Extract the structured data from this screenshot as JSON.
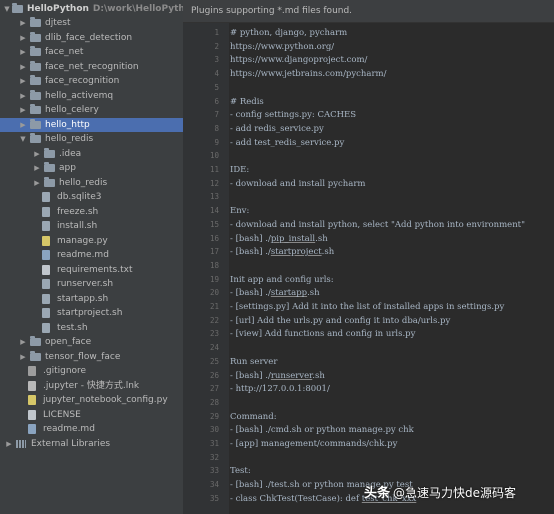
{
  "project": {
    "name": "HelloPython",
    "path": "D:\\work\\HelloPython"
  },
  "tree": [
    {
      "label": "djtest",
      "type": "folder",
      "arrow": "collapsed"
    },
    {
      "label": "dlib_face_detection",
      "type": "folder",
      "arrow": "collapsed"
    },
    {
      "label": "face_net",
      "type": "folder",
      "arrow": "collapsed"
    },
    {
      "label": "face_net_recognition",
      "type": "folder",
      "arrow": "collapsed"
    },
    {
      "label": "face_recognition",
      "type": "folder",
      "arrow": "collapsed"
    },
    {
      "label": "hello_activemq",
      "type": "folder",
      "arrow": "collapsed"
    },
    {
      "label": "hello_celery",
      "type": "folder",
      "arrow": "collapsed"
    },
    {
      "label": "hello_http",
      "type": "folder",
      "arrow": "collapsed",
      "selected": true
    },
    {
      "label": "hello_redis",
      "type": "folder",
      "arrow": "expanded"
    },
    {
      "label": ".idea",
      "type": "folder",
      "arrow": "collapsed"
    },
    {
      "label": "app",
      "type": "folder",
      "arrow": "collapsed"
    },
    {
      "label": "hello_redis",
      "type": "folder",
      "arrow": "collapsed"
    },
    {
      "label": "db.sqlite3",
      "type": "db"
    },
    {
      "label": "freeze.sh",
      "type": "sh"
    },
    {
      "label": "install.sh",
      "type": "sh"
    },
    {
      "label": "manage.py",
      "type": "py"
    },
    {
      "label": "readme.md",
      "type": "md"
    },
    {
      "label": "requirements.txt",
      "type": "txt"
    },
    {
      "label": "runserver.sh",
      "type": "sh"
    },
    {
      "label": "startapp.sh",
      "type": "sh"
    },
    {
      "label": "startproject.sh",
      "type": "sh"
    },
    {
      "label": "test.sh",
      "type": "sh"
    },
    {
      "label": "open_face",
      "type": "folder",
      "arrow": "collapsed"
    },
    {
      "label": "tensor_flow_face",
      "type": "folder",
      "arrow": "collapsed"
    },
    {
      "label": ".gitignore",
      "type": "git"
    },
    {
      "label": ".jupyter - 快捷方式.lnk",
      "type": "lnk"
    },
    {
      "label": "jupyter_notebook_config.py",
      "type": "py"
    },
    {
      "label": "LICENSE",
      "type": "txt"
    },
    {
      "label": "readme.md",
      "type": "md"
    },
    {
      "label": "External Libraries",
      "type": "libs",
      "arrow": "collapsed"
    }
  ],
  "banner": "Plugins supporting *.md files found.",
  "editor_lines": [
    {
      "n": "1",
      "text": "# python, django, pycharm"
    },
    {
      "n": "2",
      "text": "https://www.python.org/"
    },
    {
      "n": "3",
      "text": "https://www.djangoproject.com/"
    },
    {
      "n": "4",
      "text": "https://www.jetbrains.com/pycharm/"
    },
    {
      "n": "5",
      "text": ""
    },
    {
      "n": "6",
      "text": "# Redis"
    },
    {
      "n": "7",
      "text": "- config settings.py: CACHES"
    },
    {
      "n": "8",
      "text": "- add redis_service.py"
    },
    {
      "n": "9",
      "text": "- add test_redis_service.py"
    },
    {
      "n": "10",
      "text": ""
    },
    {
      "n": "11",
      "text": "IDE:"
    },
    {
      "n": "12",
      "text": "- download and install pycharm"
    },
    {
      "n": "13",
      "text": ""
    },
    {
      "n": "14",
      "text": "Env:"
    },
    {
      "n": "15",
      "text": "- download and install python, select \"Add python into environment\""
    },
    {
      "n": "16",
      "text": "- [bash] ./pip_install.sh"
    },
    {
      "n": "17",
      "text": "- [bash] ./startproject.sh"
    },
    {
      "n": "18",
      "text": ""
    },
    {
      "n": "19",
      "text": "Init app and config urls:"
    },
    {
      "n": "20",
      "text": "- [bash] ./startapp.sh"
    },
    {
      "n": "21",
      "text": "- [settings.py] Add it into the list of installed apps in settings.py"
    },
    {
      "n": "22",
      "text": "- [url] Add the urls.py and config it into dba/urls.py"
    },
    {
      "n": "23",
      "text": "- [view] Add functions and config in urls.py"
    },
    {
      "n": "24",
      "text": ""
    },
    {
      "n": "25",
      "text": "Run server"
    },
    {
      "n": "26",
      "text": "- [bash] ./runserver.sh"
    },
    {
      "n": "27",
      "text": "- http://127.0.0.1:8001/"
    },
    {
      "n": "28",
      "text": ""
    },
    {
      "n": "29",
      "text": "Command:"
    },
    {
      "n": "30",
      "text": "- [bash] ./cmd.sh or python manage.py chk"
    },
    {
      "n": "31",
      "text": "- [app] management/commands/chk.py"
    },
    {
      "n": "32",
      "text": ""
    },
    {
      "n": "33",
      "text": "Test:"
    },
    {
      "n": "34",
      "text": "- [bash] ./test.sh or python manage.py test"
    },
    {
      "n": "35",
      "text": "- class ChkTest(TestCase): def test_chk_xxx"
    }
  ],
  "watermark": {
    "brand": "头条",
    "handle": "@急速马力快de源码客"
  }
}
